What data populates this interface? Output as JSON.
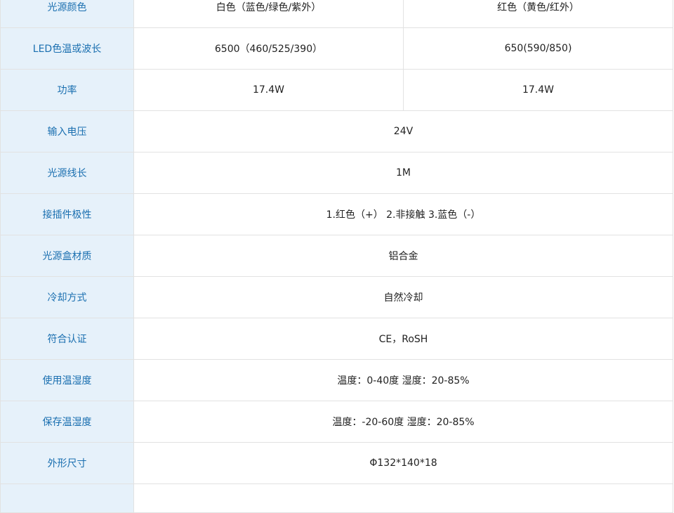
{
  "spec_table": {
    "rows": [
      {
        "label": "光源颜色",
        "values": [
          "白色（蓝色/绿色/紫外）",
          "红色（黄色/红外）"
        ]
      },
      {
        "label": "LED色温或波长",
        "values": [
          "6500（460/525/390）",
          "650(590/850)"
        ]
      },
      {
        "label": "功率",
        "values": [
          "17.4W",
          "17.4W"
        ]
      },
      {
        "label": "输入电压",
        "value": "24V"
      },
      {
        "label": "光源线长",
        "value": "1M"
      },
      {
        "label": "接插件极性",
        "value": "1.红色（+） 2.非接触 3.蓝色（-）"
      },
      {
        "label": "光源盒材质",
        "value": "铝合金"
      },
      {
        "label": "冷却方式",
        "value": "自然冷却"
      },
      {
        "label": "符合认证",
        "value": "CE，RoSH"
      },
      {
        "label": "使用温湿度",
        "value": "温度：0-40度  湿度：20-85%"
      },
      {
        "label": "保存温湿度",
        "value": "温度：-20-60度  湿度：20-85%"
      },
      {
        "label": "外形尺寸",
        "value": "Φ132*140*18"
      }
    ]
  },
  "colors": {
    "label_background": "#e6f1fa",
    "label_text": "#1a6fb0",
    "value_text": "#222222",
    "border": "#e2e2e2"
  }
}
